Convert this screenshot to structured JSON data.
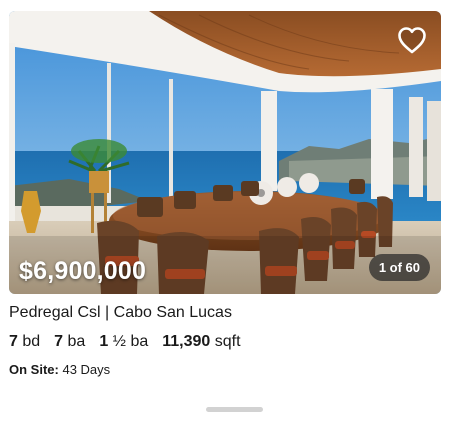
{
  "listing": {
    "price": "$6,900,000",
    "photo_counter": "1 of 60",
    "address": "Pedregal Csl | Cabo San Lucas",
    "beds_value": "7",
    "beds_unit": "bd",
    "baths_value": "7",
    "baths_unit": "ba",
    "half_baths_value": "1",
    "half_baths_unit": "½ ba",
    "sqft_value": "11,390",
    "sqft_unit": "sqft",
    "onsite_label": "On Site:",
    "onsite_value": "43 Days"
  },
  "icons": {
    "favorite": "heart-outline-icon"
  },
  "colors": {
    "text": "#1a1a1a",
    "overlay_white": "#ffffff",
    "counter_bg": "#282828",
    "handle": "#d2d2d2"
  }
}
